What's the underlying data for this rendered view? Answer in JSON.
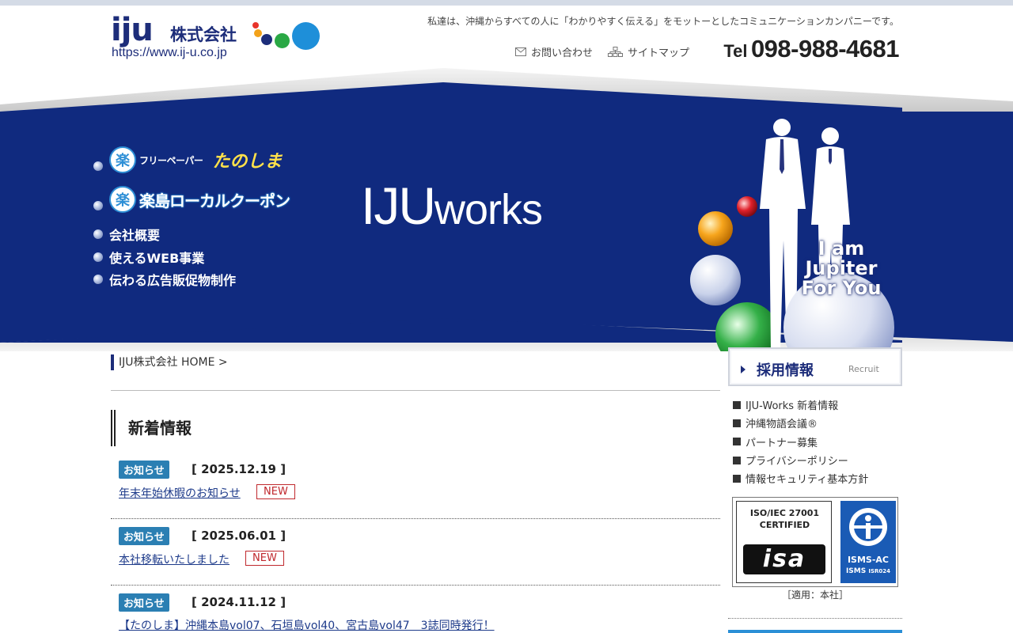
{
  "header": {
    "logo_mark": "iju",
    "logo_company": "株式会社",
    "logo_url": "https://www.ij-u.co.jp",
    "tagline": "私達は、沖縄からすべての人に「わかりやすく伝える」をモットーとしたコミュニケーションカンパニーです。",
    "contact_label": "お問い合わせ",
    "sitemap_label": "サイトマップ",
    "tel_prefix": "Tel",
    "tel_number": "098-988-4681"
  },
  "hero": {
    "freepaper_label": "フリーペーパー",
    "tanoshima": "たのしま",
    "coupon_label": "楽島ローカルクーポン",
    "menu": [
      "会社概要",
      "使えるWEB事業",
      "伝わる広告販促物制作"
    ],
    "works_ij": "IJU",
    "works_text": "works",
    "slogan": [
      "I am",
      "Jupiter",
      "For You"
    ]
  },
  "breadcrumb": "IJU株式会社 HOME >",
  "section_title": "新着情報",
  "news": [
    {
      "category": "お知らせ",
      "date": "[ 2025.12.19 ]",
      "title": "年末年始休暇のお知らせ",
      "new": "NEW"
    },
    {
      "category": "お知らせ",
      "date": "[ 2025.06.01 ]",
      "title": "本社移転いたしました",
      "new": "NEW"
    },
    {
      "category": "お知らせ",
      "date": "[ 2024.11.12 ]",
      "title": "【たのしま】沖縄本島vol07、石垣島vol40、宮古島vol47　3誌同時発行！",
      "new": ""
    }
  ],
  "sidebar": {
    "recruit_title": "採用情報",
    "recruit_sub": "Recruit",
    "links": [
      "IJU-Works 新着情報",
      "沖縄物語会議®",
      "パートナー募集",
      "プライバシーポリシー",
      "情報セキュリティ基本方針"
    ],
    "cert_line1": "ISO/IEC 27001",
    "cert_line2": "CERTIFIED",
    "cert_isa": "isa",
    "cert_isms1": "ISMS-AC",
    "cert_isms2": "ISMS",
    "cert_isms3": "ISR024",
    "applied": "［適用：本社］"
  },
  "colors": {
    "brand_navy": "#1d2d7a",
    "hero_blue": "#102a7f",
    "category_badge": "#2b7fb3",
    "new_red": "#c0282d"
  }
}
